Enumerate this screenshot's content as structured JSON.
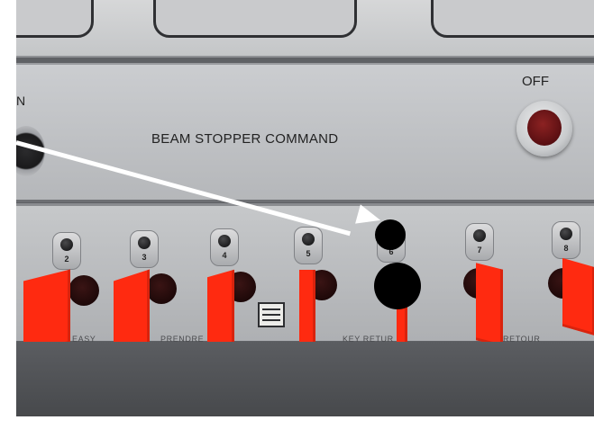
{
  "panel": {
    "title": "BEAM STOPPER COMMAND",
    "off_label": "OFF",
    "left_label_fragment": "N"
  },
  "key_slots": [
    "2",
    "3",
    "4",
    "5",
    "6",
    "7",
    "8"
  ],
  "etched_labels": [
    "EASY",
    "PRENDRE",
    "KEY RETUR",
    "RETOUR"
  ],
  "badge_text": "",
  "colors": {
    "key": "#ff2a10",
    "panel": "#c2c4c7",
    "off_button": "#6a1418",
    "arrow": "#ffffff"
  }
}
